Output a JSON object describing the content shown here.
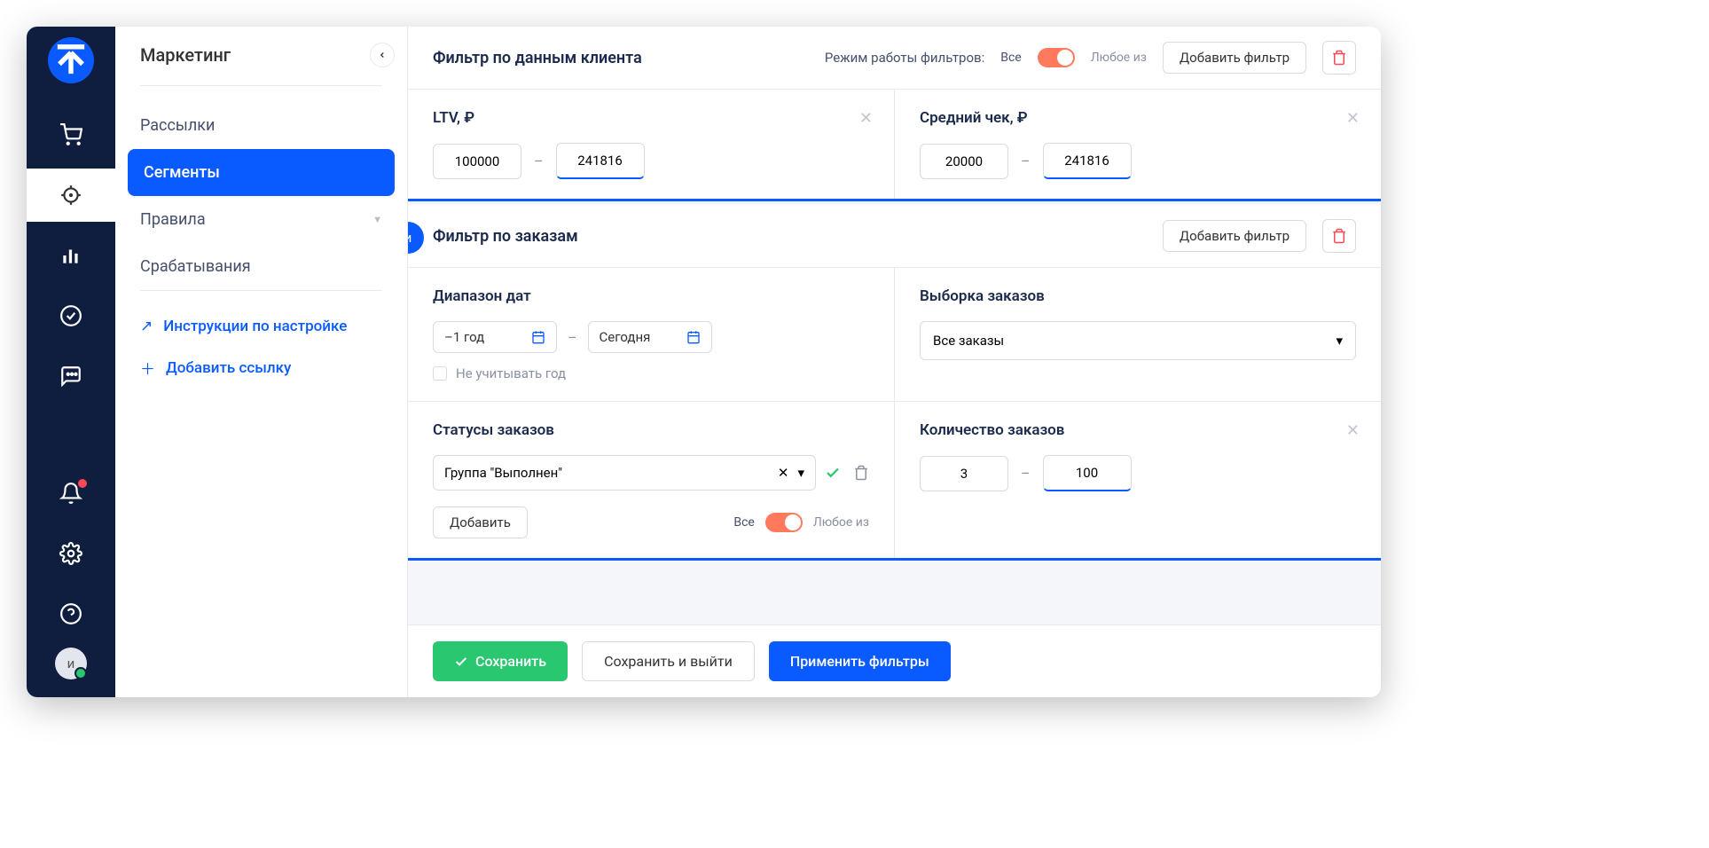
{
  "sidebar": {
    "title": "Маркетинг",
    "items": [
      "Рассылки",
      "Сегменты",
      "Правила",
      "Срабатывания"
    ],
    "active_index": 1,
    "link_instructions": "Инструкции по настройке",
    "link_add": "Добавить ссылку"
  },
  "rail": {
    "avatar_initial": "и"
  },
  "and_badge": "и",
  "client_filter": {
    "title": "Фильтр по данным клиента",
    "mode_label": "Режим работы фильтров:",
    "mode_all": "Все",
    "mode_any": "Любое из",
    "add_filter": "Добавить фильтр",
    "ltv": {
      "label": "LTV, ₽",
      "from": "100000",
      "to": "241816"
    },
    "avg": {
      "label": "Средний чек, ₽",
      "from": "20000",
      "to": "241816"
    }
  },
  "order_filter": {
    "title": "Фильтр по заказам",
    "add_filter": "Добавить фильтр",
    "date_range": {
      "label": "Диапазон дат",
      "from": "–1 год",
      "to": "Сегодня",
      "ignore_year": "Не учитывать год"
    },
    "selection": {
      "label": "Выборка заказов",
      "value": "Все заказы"
    },
    "statuses": {
      "label": "Статусы заказов",
      "value": "Группа \"Выполнен\"",
      "add": "Добавить",
      "mode_all": "Все",
      "mode_any": "Любое из"
    },
    "count": {
      "label": "Количество заказов",
      "from": "3",
      "to": "100"
    }
  },
  "footer": {
    "save": "Сохранить",
    "save_exit": "Сохранить и выйти",
    "apply": "Применить фильтры"
  }
}
